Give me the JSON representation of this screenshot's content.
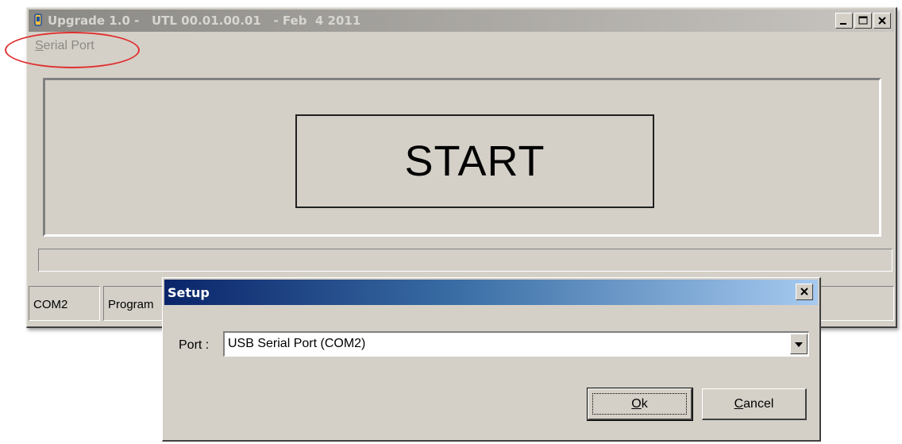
{
  "main_window": {
    "title": "Upgrade 1.0 -   UTL 00.01.00.01   - Feb  4 2011",
    "menu": {
      "serial_port": "Serial Port"
    },
    "start_button": "START",
    "status_bar": [
      "COM2",
      "Program"
    ]
  },
  "setup_dialog": {
    "title": "Setup",
    "port_label": "Port :",
    "port_value": "USB Serial Port (COM2)",
    "ok_label": "Ok",
    "cancel_label": "Cancel"
  },
  "colors": {
    "dialog_title_start": "#0a246a",
    "dialog_title_end": "#a6caf0",
    "highlight_circle": "#e03030",
    "window_face": "#d4d0c8"
  }
}
